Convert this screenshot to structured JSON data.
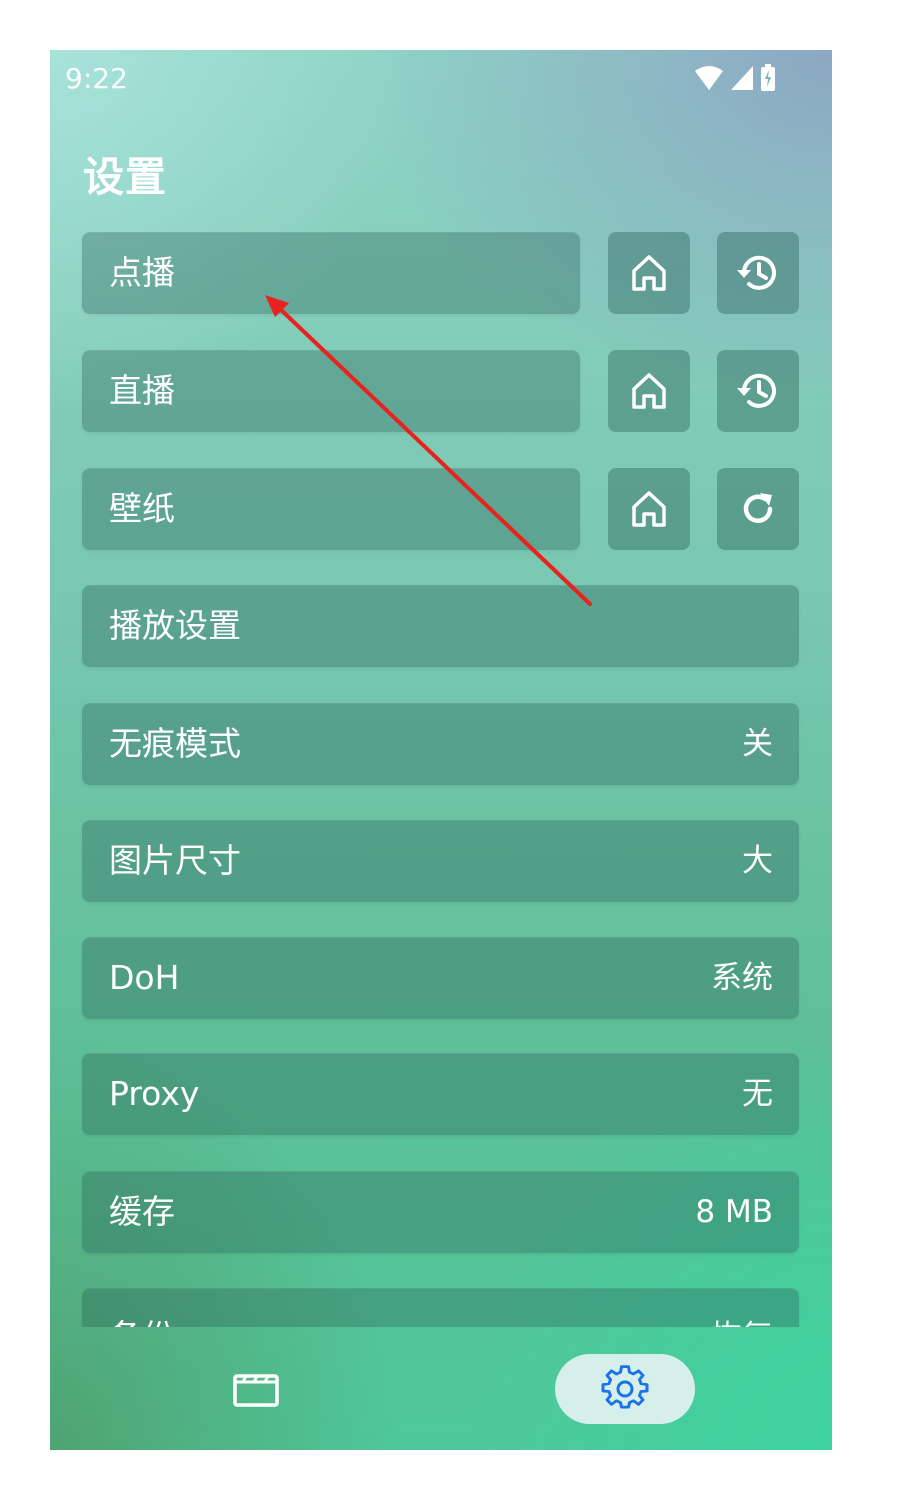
{
  "status_bar": {
    "time": "9:22",
    "icons": [
      "wifi-icon",
      "signal-icon",
      "battery-icon"
    ]
  },
  "header": {
    "title": "设置"
  },
  "settings": {
    "vod": {
      "label": "点播",
      "home_icon": "home-icon",
      "action_icon": "history-icon"
    },
    "live": {
      "label": "直播",
      "home_icon": "home-icon",
      "action_icon": "history-icon"
    },
    "wallpaper": {
      "label": "壁纸",
      "home_icon": "home-icon",
      "action_icon": "refresh-icon"
    },
    "player": {
      "label": "播放设置"
    },
    "incognito": {
      "label": "无痕模式",
      "value": "关"
    },
    "image_size": {
      "label": "图片尺寸",
      "value": "大"
    },
    "doh": {
      "label": "DoH",
      "value": "系统"
    },
    "proxy": {
      "label": "Proxy",
      "value": "无"
    },
    "cache": {
      "label": "缓存",
      "value": "8 MB"
    },
    "backup": {
      "label": "备份",
      "value": "恢复"
    }
  },
  "bottom_nav": {
    "items": [
      {
        "icon": "clapperboard-icon",
        "active": false
      },
      {
        "icon": "gear-icon",
        "active": true
      }
    ]
  },
  "colors": {
    "annotation_arrow": "#e8231d",
    "active_nav_bg": "#d6efea",
    "active_nav_icon": "#1a73e8"
  }
}
